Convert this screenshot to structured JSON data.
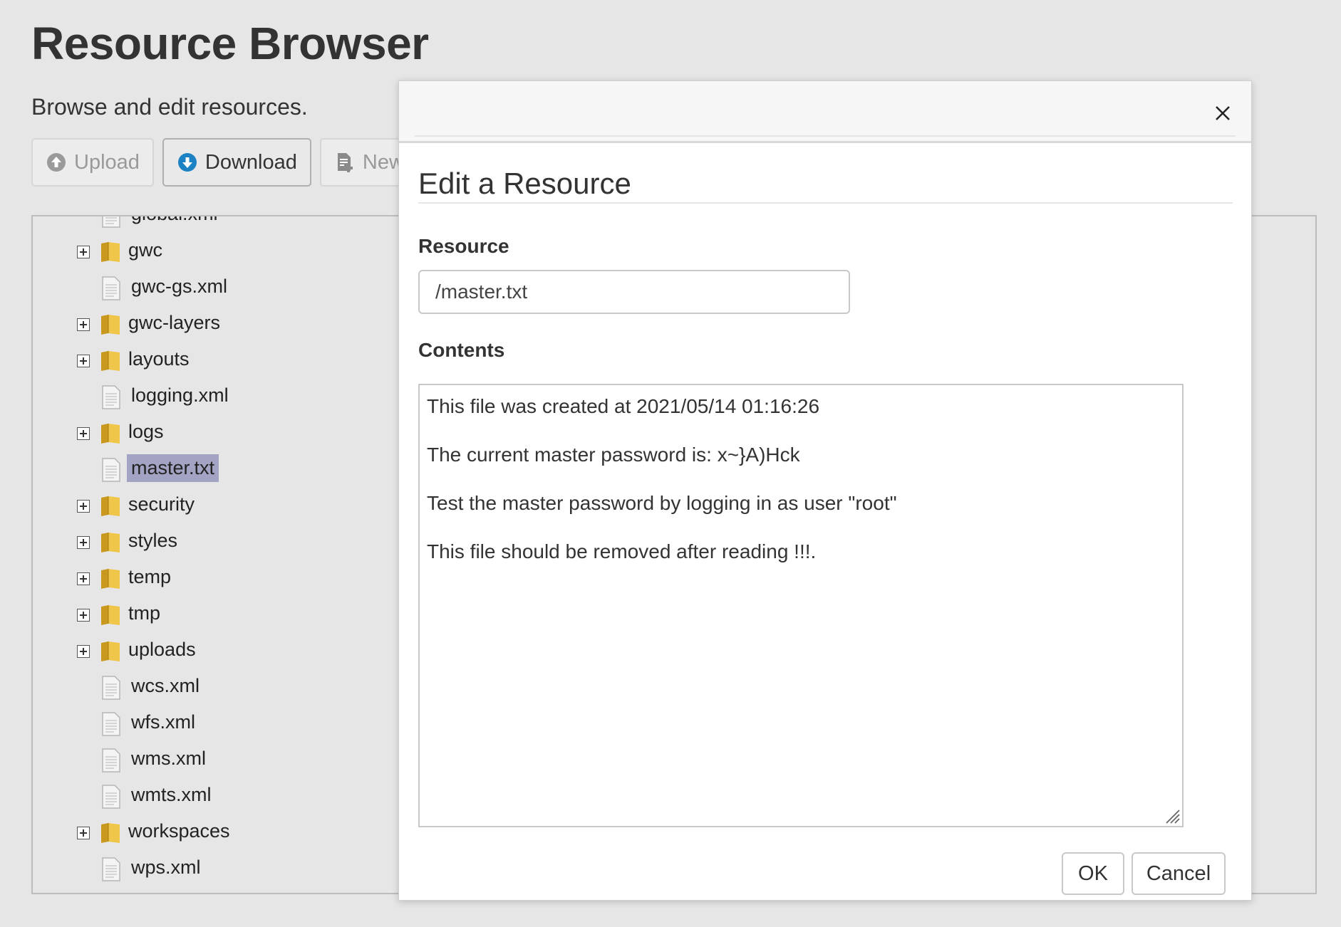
{
  "header": {
    "title": "Resource Browser",
    "subtitle": "Browse and edit resources."
  },
  "toolbar": {
    "upload_label": "Upload",
    "download_label": "Download",
    "new_label": "New"
  },
  "tree": {
    "items": [
      {
        "label": "global.xml",
        "type": "file",
        "expandable": false
      },
      {
        "label": "gwc",
        "type": "folder",
        "expandable": true
      },
      {
        "label": "gwc-gs.xml",
        "type": "file",
        "expandable": false
      },
      {
        "label": "gwc-layers",
        "type": "folder",
        "expandable": true
      },
      {
        "label": "layouts",
        "type": "folder",
        "expandable": true
      },
      {
        "label": "logging.xml",
        "type": "file",
        "expandable": false
      },
      {
        "label": "logs",
        "type": "folder",
        "expandable": true
      },
      {
        "label": "master.txt",
        "type": "file",
        "expandable": false,
        "selected": true
      },
      {
        "label": "security",
        "type": "folder",
        "expandable": true
      },
      {
        "label": "styles",
        "type": "folder",
        "expandable": true
      },
      {
        "label": "temp",
        "type": "folder",
        "expandable": true
      },
      {
        "label": "tmp",
        "type": "folder",
        "expandable": true
      },
      {
        "label": "uploads",
        "type": "folder",
        "expandable": true
      },
      {
        "label": "wcs.xml",
        "type": "file",
        "expandable": false
      },
      {
        "label": "wfs.xml",
        "type": "file",
        "expandable": false
      },
      {
        "label": "wms.xml",
        "type": "file",
        "expandable": false
      },
      {
        "label": "wmts.xml",
        "type": "file",
        "expandable": false
      },
      {
        "label": "workspaces",
        "type": "folder",
        "expandable": true
      },
      {
        "label": "wps.xml",
        "type": "file",
        "expandable": false
      }
    ]
  },
  "dialog": {
    "title": "Edit a Resource",
    "resource_label": "Resource",
    "resource_value": "/master.txt",
    "contents_label": "Contents",
    "contents_lines": [
      "This file was created at 2021/05/14 01:16:26",
      "The current master password is: x~}A)Hck",
      "Test the master password by logging in as user \"root\"",
      "This file should be removed after reading !!!."
    ],
    "ok_label": "OK",
    "cancel_label": "Cancel"
  },
  "colors": {
    "background": "#e6e6e6",
    "selection": "#a3a3c4",
    "download_icon": "#1d82c4",
    "folder": "#e8b93a"
  }
}
